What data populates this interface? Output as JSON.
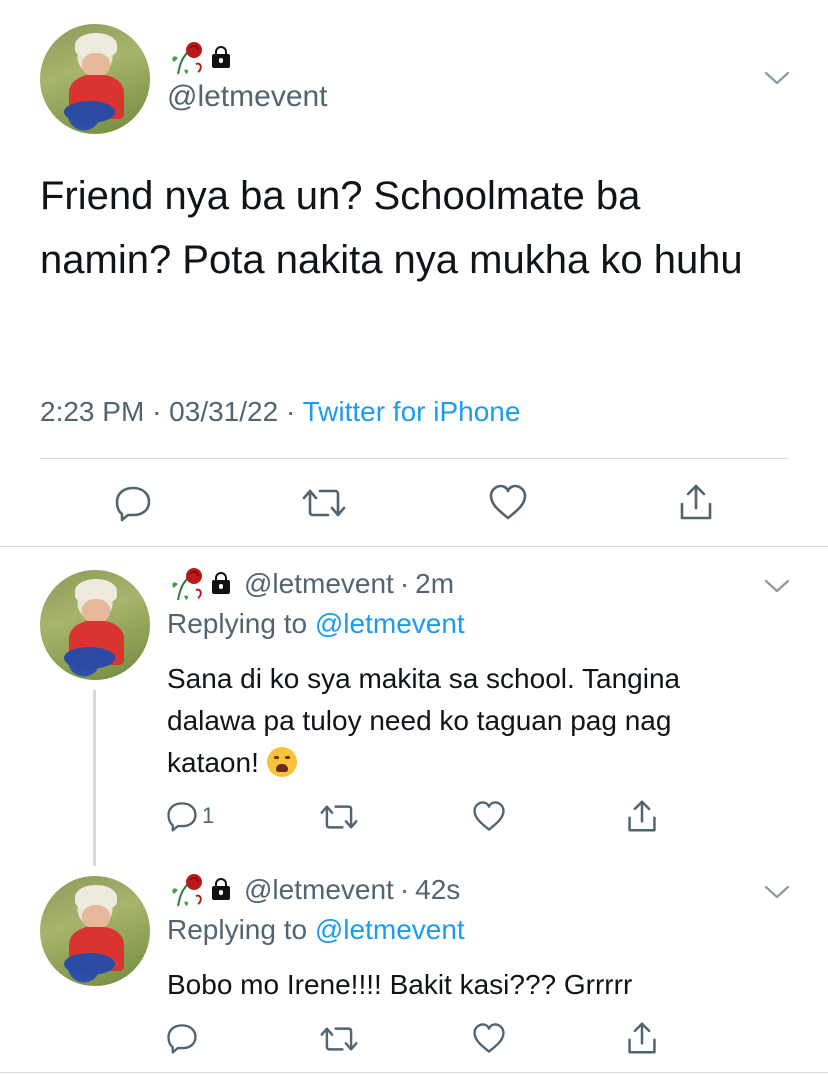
{
  "main_tweet": {
    "handle": "@letmevent",
    "text": "Friend nya ba un? Schoolmate ba namin? Pota nakita nya mukha ko huhu",
    "time": "2:23 PM",
    "sep1": "·",
    "date": "03/31/22",
    "sep2": "·",
    "source": "Twitter for iPhone"
  },
  "replies": [
    {
      "handle": "@letmevent",
      "sep": "·",
      "age": "2m",
      "replying_prefix": "Replying to",
      "replying_to": "@letmevent",
      "text": "Sana di ko sya makita sa school. Tangina dalawa pa tuloy need ko taguan pag nag kataon!",
      "reply_count": "1"
    },
    {
      "handle": "@letmevent",
      "sep": "·",
      "age": "42s",
      "replying_prefix": "Replying to",
      "replying_to": "@letmevent",
      "text": "Bobo mo Irene!!!! Bakit kasi??? Grrrrr",
      "reply_count": ""
    }
  ],
  "icons": [
    "rose-emoji-icon",
    "lock-icon",
    "chevron-down-icon",
    "reply-icon",
    "retweet-icon",
    "like-icon",
    "share-icon",
    "loudly-crying-emoji-icon"
  ],
  "colors": {
    "link": "#1d9bf0",
    "secondary": "#536471",
    "text": "#0f1419"
  }
}
